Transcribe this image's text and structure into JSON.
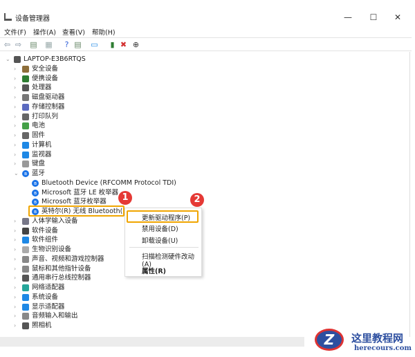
{
  "window": {
    "title": "设备管理器",
    "minimize": "—",
    "maximize": "☐",
    "close": "✕"
  },
  "menu": [
    "文件(F)",
    "操作(A)",
    "查看(V)",
    "帮助(H)"
  ],
  "toolbar": [
    {
      "icon": "back-icon",
      "glyph": "⇦",
      "color": "#7a8a9a"
    },
    {
      "icon": "forward-icon",
      "glyph": "⇨",
      "color": "#7a8a9a"
    },
    {
      "icon": "properties-window-icon",
      "glyph": "▤",
      "color": "#6a8a6a"
    },
    {
      "icon": "document-icon",
      "glyph": "▦",
      "color": "#9aa"
    },
    {
      "icon": "help-icon",
      "glyph": "?",
      "color": "#2a5bd7"
    },
    {
      "icon": "view-icon",
      "glyph": "▤",
      "color": "#6a8a6a"
    },
    {
      "icon": "monitor-icon",
      "glyph": "▭",
      "color": "#1e88e5"
    },
    {
      "icon": "update-driver-icon",
      "glyph": "▮",
      "color": "#2e7d32"
    },
    {
      "icon": "uninstall-icon",
      "glyph": "✖",
      "color": "#d32f2f"
    },
    {
      "icon": "download-icon",
      "glyph": "⊕",
      "color": "#333"
    }
  ],
  "tree": {
    "root": "LAPTOP-E3B6RTQS",
    "before": [
      {
        "label": "安全设备",
        "color": "#8d6e3a"
      },
      {
        "label": "便携设备",
        "color": "#2e7d32"
      },
      {
        "label": "处理器",
        "color": "#555"
      },
      {
        "label": "磁盘驱动器",
        "color": "#777"
      },
      {
        "label": "存储控制器",
        "color": "#5c6bc0"
      },
      {
        "label": "打印队列",
        "color": "#666"
      },
      {
        "label": "电池",
        "color": "#43a047"
      },
      {
        "label": "固件",
        "color": "#666"
      },
      {
        "label": "计算机",
        "color": "#1e88e5"
      },
      {
        "label": "监视器",
        "color": "#1e88e5"
      },
      {
        "label": "键盘",
        "color": "#999"
      }
    ],
    "bluetooth": {
      "label": "蓝牙",
      "children": [
        "Bluetooth Device (RFCOMM Protocol TDI)",
        "Microsoft 蓝牙 LE 枚举器",
        "Microsoft 蓝牙枚举器",
        "英特尔(R) 无线 Bluetooth(R)"
      ]
    },
    "after": [
      {
        "label": "人体学输入设备",
        "color": "#778"
      },
      {
        "label": "软件设备",
        "color": "#444"
      },
      {
        "label": "软件组件",
        "color": "#1e88e5"
      },
      {
        "label": "生物识别设备",
        "color": "#aaa"
      },
      {
        "label": "声音、视频和游戏控制器",
        "color": "#888"
      },
      {
        "label": "鼠标和其他指针设备",
        "color": "#888"
      },
      {
        "label": "通用串行总线控制器",
        "color": "#555"
      },
      {
        "label": "网络适配器",
        "color": "#26a69a"
      },
      {
        "label": "系统设备",
        "color": "#1e88e5"
      },
      {
        "label": "显示适配器",
        "color": "#1e88e5"
      },
      {
        "label": "音频输入和输出",
        "color": "#888"
      },
      {
        "label": "照相机",
        "color": "#555"
      }
    ]
  },
  "context_menu": {
    "update": "更新驱动程序(P)",
    "disable": "禁用设备(D)",
    "uninstall": "卸载设备(U)",
    "scan": "扫描检测硬件改动(A)",
    "properties": "属性(R)"
  },
  "badges": {
    "one": "1",
    "two": "2"
  },
  "watermark": {
    "logo": "Z",
    "cn": "这里教程网",
    "en": "herecours.com"
  },
  "colors": {
    "highlight": "#f0a500",
    "badge": "#e53935"
  }
}
